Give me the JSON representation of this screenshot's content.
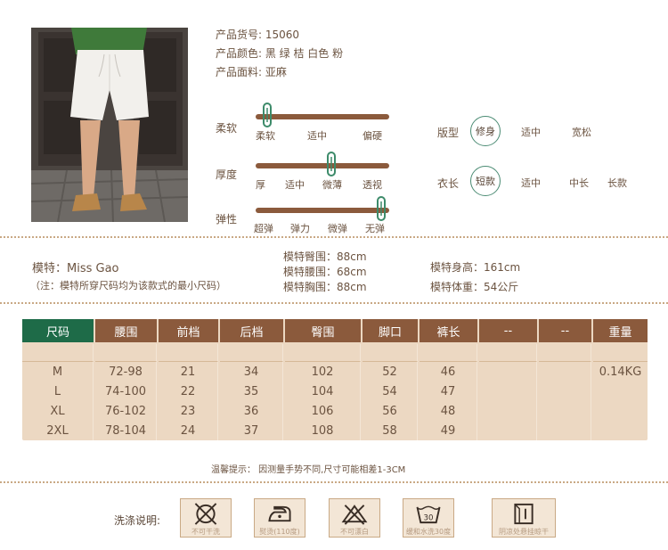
{
  "product": {
    "code_label": "产品货号: 15060",
    "color_label": "产品颜色:  黑 绿 桔 白色 粉",
    "fabric_label": "产品面料: 亚麻"
  },
  "sliders": [
    {
      "label": "柔软",
      "ticks": [
        "柔软",
        "适中",
        "偏硬"
      ],
      "level": 0.05
    },
    {
      "label": "厚度",
      "ticks": [
        "厚",
        "适中",
        "微薄",
        "透视"
      ],
      "level": 0.57
    },
    {
      "label": "弹性",
      "ticks": [
        "超弹",
        "弹力",
        "微弹",
        "无弹"
      ],
      "level": 0.98
    }
  ],
  "fit": {
    "label": "版型",
    "options": [
      "修身",
      "适中",
      "宽松"
    ],
    "selected": "修身"
  },
  "length": {
    "label": "衣长",
    "options": [
      "短款",
      "适中",
      "中长",
      "长款"
    ],
    "selected": "短款"
  },
  "model": {
    "name": "模特：Miss Gao",
    "note": "（注：模特所穿尺码均为该款式的最小尺码）",
    "hip": "模特臀围：88cm",
    "waist": "模特腰围：68cm",
    "chest": "模特胸围：88cm",
    "height": "模特身高：161cm",
    "weight": "模特体重：54公斤"
  },
  "size_table": {
    "headers": [
      "尺码",
      "腰围",
      "前档",
      "后档",
      "臀围",
      "脚口",
      "裤长",
      "--",
      "--",
      "重量"
    ],
    "rows": [
      [
        "",
        "",
        "",
        "",
        "",
        "",
        "",
        "",
        "",
        ""
      ],
      [
        "M",
        "72-98",
        "21",
        "34",
        "102",
        "52",
        "46",
        "",
        "",
        "0.14KG"
      ],
      [
        "L",
        "74-100",
        "22",
        "35",
        "104",
        "54",
        "47",
        "",
        "",
        ""
      ],
      [
        "XL",
        "76-102",
        "23",
        "36",
        "106",
        "56",
        "48",
        "",
        "",
        ""
      ],
      [
        "2XL",
        "78-104",
        "24",
        "37",
        "108",
        "58",
        "49",
        "",
        "",
        ""
      ]
    ]
  },
  "tip": "温馨提示：  因测量手势不同,尺寸可能相差1-3CM",
  "care": {
    "label": "洗涤说明:",
    "items": [
      {
        "icon": "no-dry-clean-icon",
        "text": "不可干洗"
      },
      {
        "icon": "iron-icon",
        "text": "熨烫(110度)"
      },
      {
        "icon": "no-bleach-icon",
        "text": "不可漂白"
      },
      {
        "icon": "wash-30-icon",
        "text": "缓和水洗30度"
      },
      {
        "icon": "hang-dry-shade-icon",
        "text": "阴凉处悬挂晾干"
      }
    ],
    "wash_temp": "30"
  }
}
